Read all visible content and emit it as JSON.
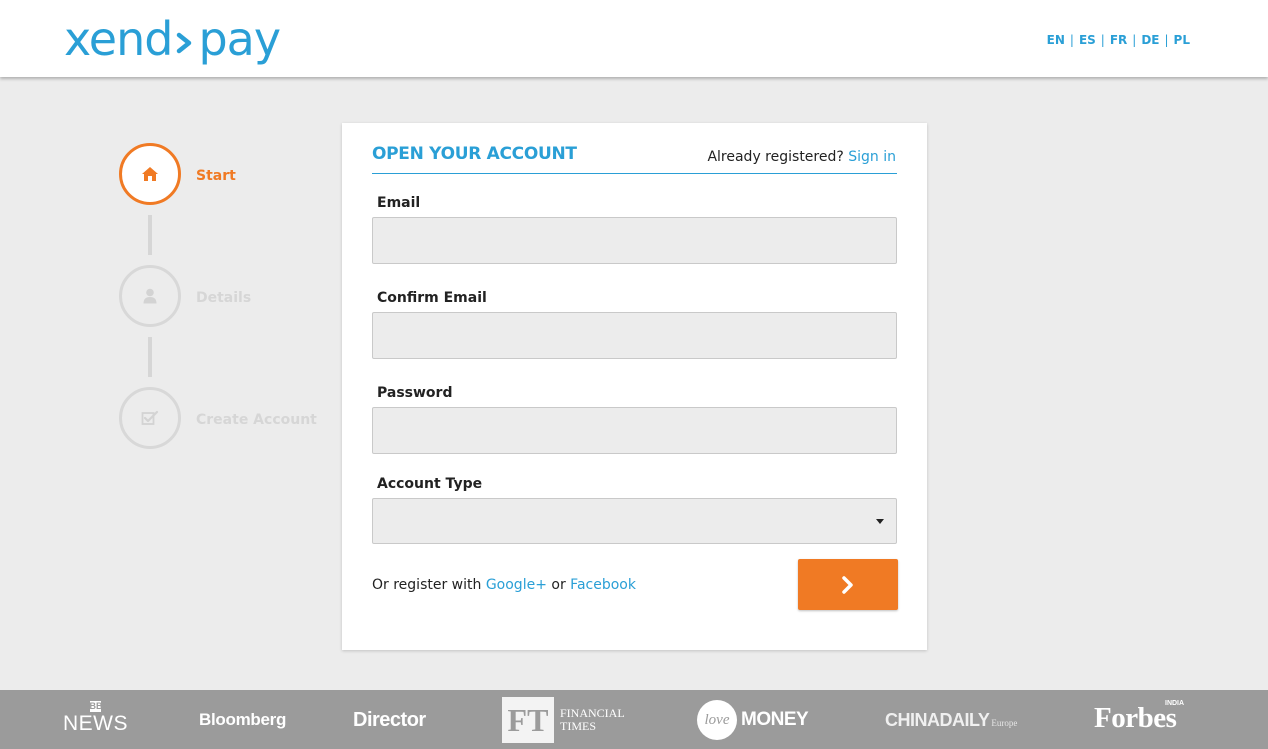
{
  "header": {
    "logo_left": "xend",
    "logo_right": "pay",
    "languages": [
      "EN",
      "ES",
      "FR",
      "DE",
      "PL"
    ]
  },
  "steps": [
    {
      "label": "Start",
      "icon": "home-icon",
      "active": true
    },
    {
      "label": "Details",
      "icon": "user-icon",
      "active": false
    },
    {
      "label": "Create Account",
      "icon": "check-square-icon",
      "active": false
    }
  ],
  "form": {
    "title": "OPEN YOUR ACCOUNT",
    "already_text": "Already registered?",
    "sign_in": "Sign in",
    "email_label": "Email",
    "email_value": "",
    "confirm_email_label": "Confirm Email",
    "confirm_email_value": "",
    "password_label": "Password",
    "password_value": "",
    "account_type_label": "Account Type",
    "account_type_value": "",
    "or_register": "Or register with",
    "google": "Google+",
    "or": "or",
    "facebook": "Facebook"
  },
  "press": {
    "bbc_top": "BBC",
    "bbc_bottom": "NEWS",
    "bloomberg": "Bloomberg",
    "director": "Director",
    "ft_mark": "FT",
    "ft_line1": "FINANCIAL",
    "ft_line2": "TIMES",
    "love_mark": "love",
    "love_text": "MONEY",
    "chinadaily": "CHINADAILY",
    "chinadaily_sub": "Europe",
    "forbes": "Forbes",
    "forbes_sub": "INDIA"
  },
  "colors": {
    "brand_blue": "#2a9fd6",
    "accent_orange": "#f07a24",
    "background": "#ececec",
    "press_bar": "#9b9b9b"
  }
}
